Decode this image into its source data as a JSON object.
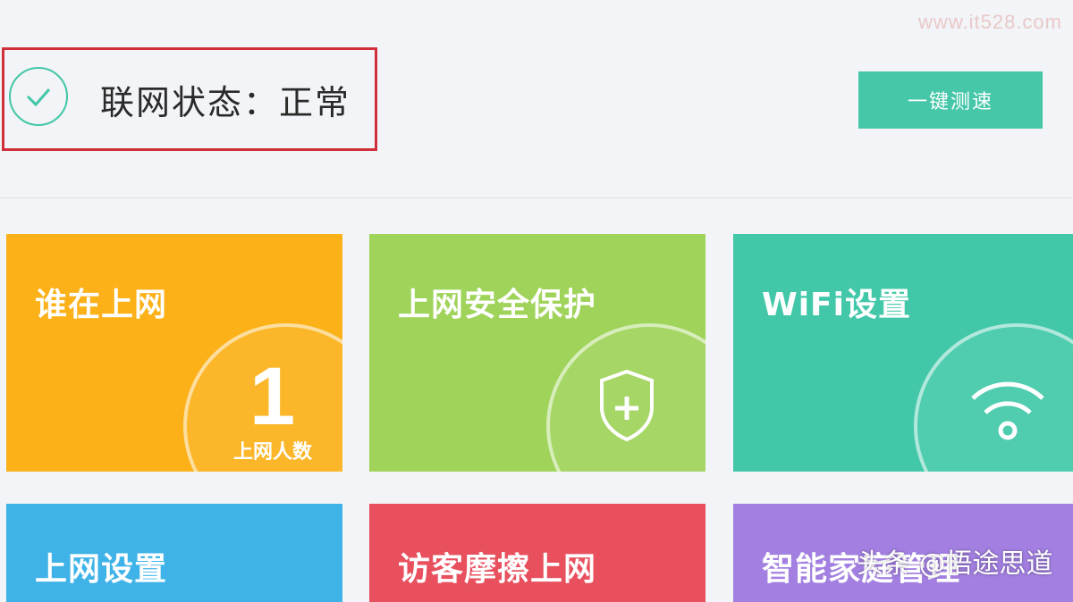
{
  "watermark_top": "www.it528.com",
  "status": {
    "text": "联网状态：正常",
    "icon": "checkmark-circle-icon"
  },
  "speed_test": {
    "label": "一键测速"
  },
  "tiles": [
    {
      "title": "谁在上网",
      "count": "1",
      "count_label": "上网人数",
      "color": "#fbb117"
    },
    {
      "title": "上网安全保护",
      "icon": "shield-plus-icon",
      "color": "#9fd35a"
    },
    {
      "title": "WiFi设置",
      "icon": "wifi-icon",
      "color": "#42c8a9"
    },
    {
      "title": "上网设置",
      "color": "#3fb3e8"
    },
    {
      "title": "访客摩擦上网",
      "color": "#e8505e"
    },
    {
      "title": "智能家庭管理",
      "color": "#a27fe0"
    }
  ],
  "watermark_bottom": "头条 @悟途思道"
}
